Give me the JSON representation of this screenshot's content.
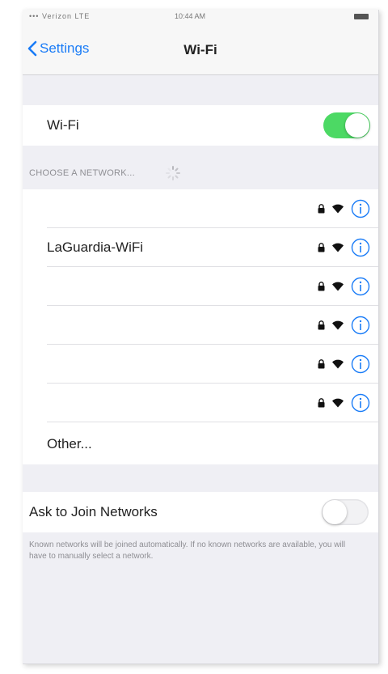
{
  "status_bar": {
    "carrier": "••• Verizon LTE",
    "time": "10:44 AM"
  },
  "navbar": {
    "back_label": "Settings",
    "title": "Wi-Fi"
  },
  "wifi_toggle": {
    "label": "Wi-Fi",
    "state": "on",
    "color": "#4cd964"
  },
  "section_header": "CHOOSE A NETWORK...",
  "networks": [
    {
      "name": "",
      "locked": true,
      "icon": "wifi-icon"
    },
    {
      "name": "LaGuardia-WiFi",
      "locked": true,
      "icon": "wifi-icon"
    },
    {
      "name": "",
      "locked": true,
      "icon": "wifi-icon"
    },
    {
      "name": "",
      "locked": true,
      "icon": "wifi-icon"
    },
    {
      "name": "",
      "locked": true,
      "icon": "wifi-icon"
    },
    {
      "name": "",
      "locked": true,
      "icon": "wifi-icon"
    }
  ],
  "other_label": "Other...",
  "ask_to_join": {
    "label": "Ask to Join Networks",
    "state": "off",
    "footer": "Known networks will be joined automatically. If no known networks are available, you will have to manually select a network."
  },
  "accent_color": "#1a7cf7"
}
